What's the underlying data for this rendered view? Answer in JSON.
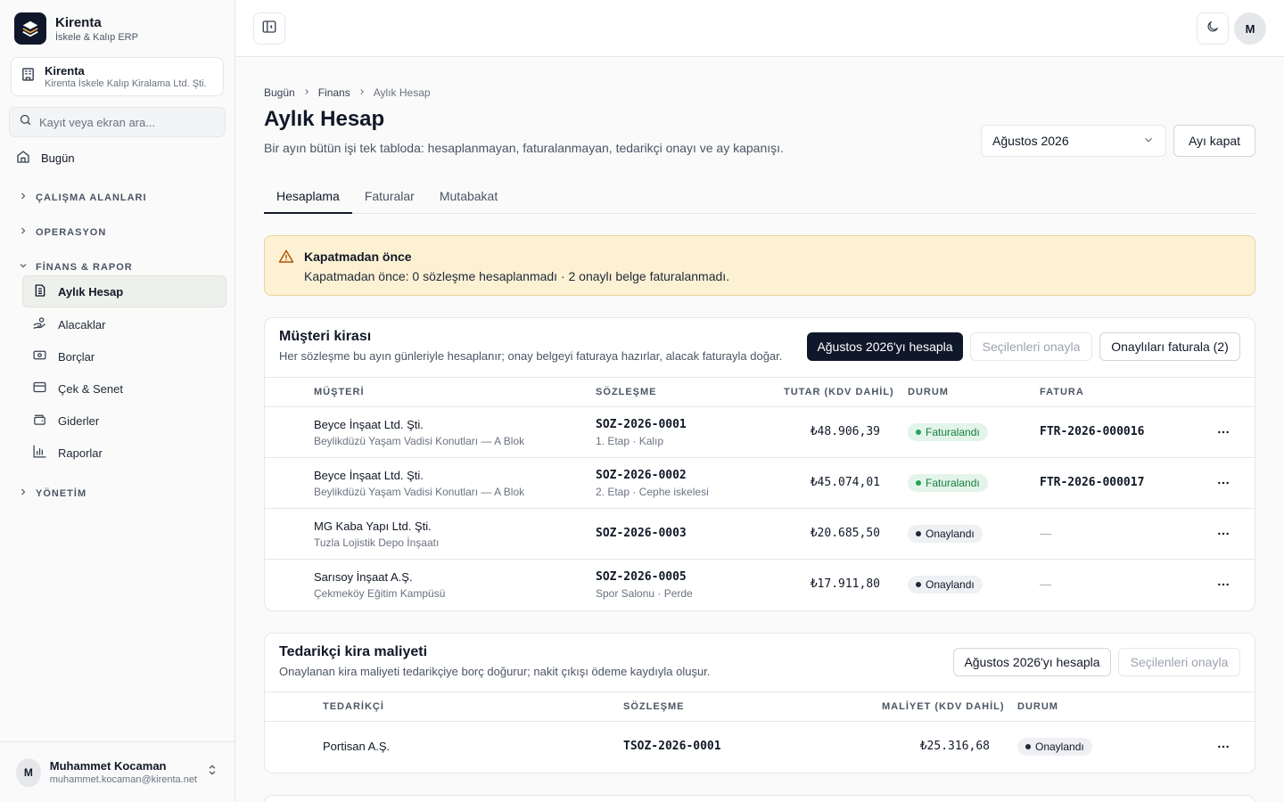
{
  "brand": {
    "name": "Kirenta",
    "subtitle": "İskele & Kalıp ERP"
  },
  "tenant": {
    "name": "Kirenta",
    "legal_name": "Kirenta İskele Kalıp Kiralama Ltd. Şti."
  },
  "search": {
    "placeholder": "Kayıt veya ekran ara..."
  },
  "nav": {
    "home": "Bugün",
    "sections": {
      "workspaces": "ÇALIŞMA ALANLARI",
      "operations": "OPERASYON",
      "finance": "FİNANS & RAPOR",
      "admin": "YÖNETİM"
    },
    "finance_items": [
      {
        "label": "Aylık Hesap",
        "icon": "file-text-icon"
      },
      {
        "label": "Alacaklar",
        "icon": "hand-coins-icon"
      },
      {
        "label": "Borçlar",
        "icon": "banknote-icon"
      },
      {
        "label": "Çek & Senet",
        "icon": "card-icon"
      },
      {
        "label": "Giderler",
        "icon": "wallet-icon"
      },
      {
        "label": "Raporlar",
        "icon": "bar-chart-icon"
      }
    ]
  },
  "user": {
    "initial": "M",
    "name": "Muhammet Kocaman",
    "email": "muhammet.kocaman@kirenta.net"
  },
  "topbar": {
    "avatar_initial": "M"
  },
  "breadcrumb": [
    "Bugün",
    "Finans",
    "Aylık Hesap"
  ],
  "page": {
    "title": "Aylık Hesap",
    "description": "Bir ayın bütün işi tek tabloda: hesaplanmayan, faturalanmayan, tedarikçi onayı ve ay kapanışı.",
    "month": "Ağustos 2026",
    "close_month": "Ayı kapat"
  },
  "tabs": [
    "Hesaplama",
    "Faturalar",
    "Mutabakat"
  ],
  "alert": {
    "title": "Kapatmadan önce",
    "text": "Kapatmadan önce: 0 sözleşme hesaplanmadı · 2 onaylı belge faturalanmadı."
  },
  "customer": {
    "title": "Müşteri kirası",
    "description": "Her sözleşme bu ayın günleriyle hesaplanır; onay belgeyi faturaya hazırlar, alacak faturayla doğar.",
    "calc_button": "Ağustos 2026'yı hesapla",
    "approve_button": "Seçilenleri onayla",
    "invoice_button": "Onaylıları faturala (2)",
    "columns": [
      "MÜŞTERİ",
      "SÖZLEŞME",
      "TUTAR (KDV DAHİL)",
      "DURUM",
      "FATURA"
    ],
    "rows": [
      {
        "customer": "Beyce İnşaat Ltd. Şti.",
        "project": "Beylikdüzü Yaşam Vadisi Konutları — A Blok",
        "contract": "SOZ-2026-0001",
        "contract_sub": "1. Etap · Kalıp",
        "amount": "₺48.906,39",
        "status": "Faturalandı",
        "invoice": "FTR-2026-000016"
      },
      {
        "customer": "Beyce İnşaat Ltd. Şti.",
        "project": "Beylikdüzü Yaşam Vadisi Konutları — A Blok",
        "contract": "SOZ-2026-0002",
        "contract_sub": "2. Etap · Cephe iskelesi",
        "amount": "₺45.074,01",
        "status": "Faturalandı",
        "invoice": "FTR-2026-000017"
      },
      {
        "customer": "MG Kaba Yapı Ltd. Şti.",
        "project": "Tuzla Lojistik Depo İnşaatı",
        "contract": "SOZ-2026-0003",
        "contract_sub": "",
        "amount": "₺20.685,50",
        "status": "Onaylandı",
        "invoice": "—"
      },
      {
        "customer": "Sarısoy İnşaat A.Ş.",
        "project": "Çekmeköy Eğitim Kampüsü",
        "contract": "SOZ-2026-0005",
        "contract_sub": "Spor Salonu · Perde",
        "amount": "₺17.911,80",
        "status": "Onaylandı",
        "invoice": "—"
      }
    ]
  },
  "supplier": {
    "title": "Tedarikçi kira maliyeti",
    "description": "Onaylanan kira maliyeti tedarikçiye borç doğurur; nakit çıkışı ödeme kaydıyla oluşur.",
    "calc_button": "Ağustos 2026'yı hesapla",
    "approve_button": "Seçilenleri onayla",
    "columns": [
      "TEDARİKÇİ",
      "SÖZLEŞME",
      "MALİYET (KDV DAHİL)",
      "DURUM"
    ],
    "rows": [
      {
        "supplier": "Portisan A.Ş.",
        "contract": "TSOZ-2026-0001",
        "amount": "₺25.316,68",
        "status": "Onaylandı"
      }
    ]
  }
}
